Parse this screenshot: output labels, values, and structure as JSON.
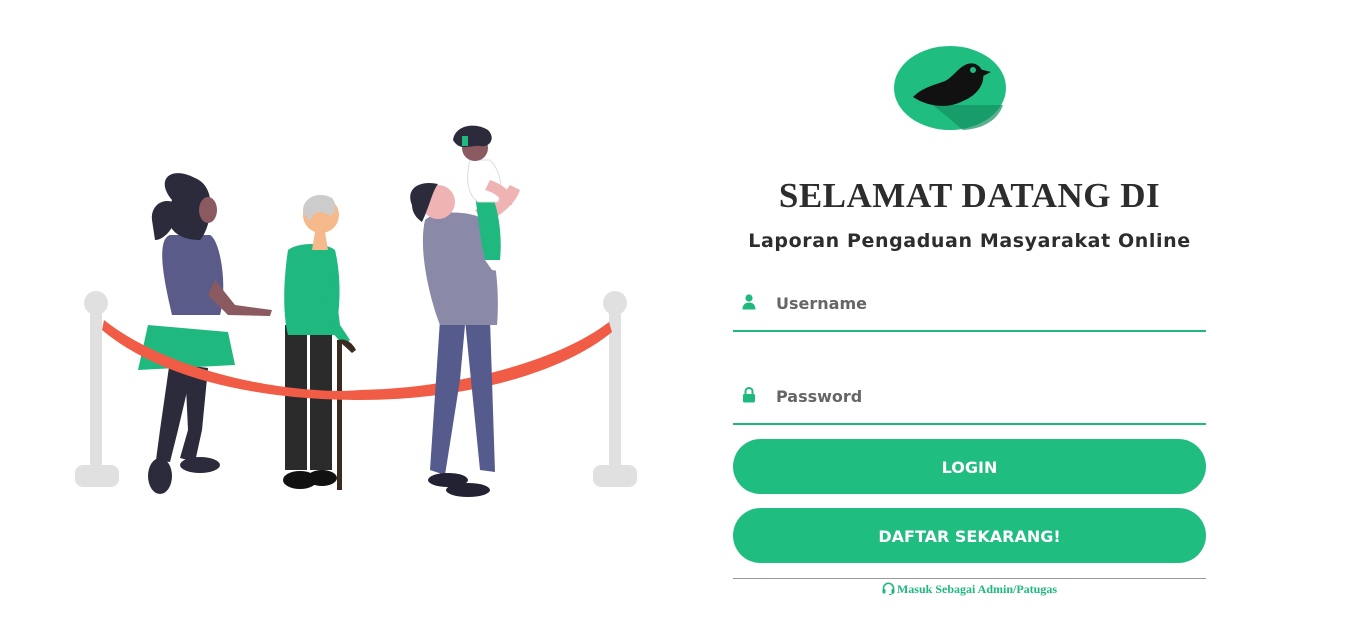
{
  "brand": {
    "logo_icon": "bird-logo-icon",
    "accent_color": "#1fbd80",
    "text_color": "#2d2d2d"
  },
  "welcome": {
    "title": "SELAMAT DATANG DI",
    "subtitle": "Laporan Pengaduan Masyarakat Online"
  },
  "form": {
    "username": {
      "icon": "user-icon",
      "placeholder": "Username",
      "value": ""
    },
    "password": {
      "icon": "lock-icon",
      "placeholder": "Password",
      "value": ""
    },
    "login_label": "LOGIN",
    "register_label": "DAFTAR SEKARANG!"
  },
  "footer": {
    "admin_icon": "headset-icon",
    "admin_link_label": "Masuk Sebagai Admin/Patugas"
  },
  "illustration": {
    "icon": "people-queue-illustration"
  }
}
